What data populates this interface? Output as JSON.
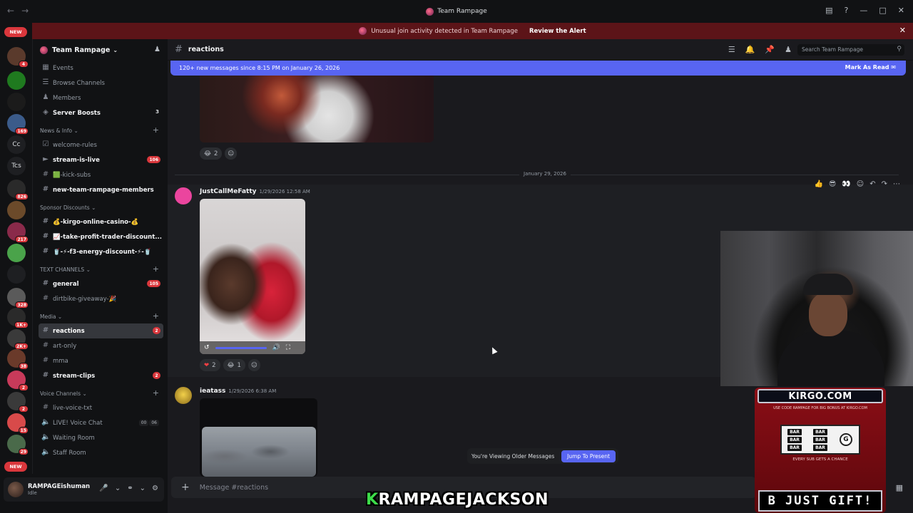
{
  "titlebar": {
    "title": "Team Rampage"
  },
  "alert": {
    "text": "Unusual join activity detected in Team Rampage",
    "link": "Review the Alert"
  },
  "rail": {
    "new_top": "NEW",
    "new_bottom": "NEW",
    "servers": [
      {
        "label": "",
        "badge": "4"
      },
      {
        "label": "",
        "badge": ""
      },
      {
        "label": "",
        "badge": ""
      },
      {
        "label": "",
        "badge": "169"
      },
      {
        "label": "Cc",
        "badge": ""
      },
      {
        "label": "Tcs",
        "badge": ""
      },
      {
        "label": "",
        "badge": "826"
      },
      {
        "label": "",
        "badge": ""
      },
      {
        "label": "",
        "badge": "217"
      },
      {
        "label": "",
        "badge": ""
      },
      {
        "label": "",
        "badge": ""
      },
      {
        "label": "",
        "badge": "328"
      },
      {
        "label": "",
        "badge": "1K+"
      },
      {
        "label": "",
        "badge": "2K+"
      },
      {
        "label": "",
        "badge": "38"
      },
      {
        "label": "",
        "badge": "2"
      },
      {
        "label": "",
        "badge": "2"
      },
      {
        "label": "",
        "badge": "15"
      },
      {
        "label": "",
        "badge": "29"
      }
    ]
  },
  "server": {
    "name": "Team Rampage"
  },
  "sidebar": {
    "events": "Events",
    "browse": "Browse Channels",
    "members": "Members",
    "boosts": "Server Boosts",
    "boosts_badge": "3",
    "cat_news": "News & Info",
    "welcome": "welcome-rules",
    "stream_live": "stream-is-live",
    "stream_live_badge": "106",
    "kick_subs": "🟩-kick-subs",
    "new_members": "new-team-rampage-members",
    "cat_sponsor": "Sponsor Discounts",
    "casino": "💰-kirgo-online-casino-💰",
    "takeprofit": "📈-take-profit-trader-discount...",
    "energy": "🥤-⚡-f3-energy-discount-⚡-🥤",
    "cat_text": "TEXT CHANNELS",
    "general": "general",
    "general_badge": "105",
    "dirtbike": "dirtbike-giveaway-🎉",
    "cat_media": "Media",
    "reactions": "reactions",
    "reactions_badge": "2",
    "artonly": "art-only",
    "mma": "mma",
    "clips": "stream-clips",
    "clips_badge": "2",
    "cat_voice": "Voice Channels",
    "livevoicetxt": "live-voice-txt",
    "livevc": "LIVE! Voice Chat",
    "livevc_n1": "00",
    "livevc_n2": "06",
    "waiting": "Waiting Room",
    "staff": "Staff Room"
  },
  "user": {
    "name": "RAMPAGEishuman",
    "status": "Idle"
  },
  "channel": {
    "name": "reactions",
    "search_placeholder": "Search Team Rampage"
  },
  "newbar": {
    "text": "120+ new messages since 8:15 PM on January 26, 2026",
    "action": "Mark As Read"
  },
  "messages": {
    "top_react_count": "2",
    "date_divider": "January 29, 2026",
    "m1": {
      "author": "JustCallMeFatty",
      "time": "1/29/2026 12:58 AM",
      "heart_count": "2",
      "laugh_count": "1"
    },
    "m2": {
      "author": "ieatass",
      "time": "1/29/2026 6:38 AM"
    }
  },
  "older": {
    "text": "You're Viewing Older Messages",
    "jump": "Jump To Present"
  },
  "composer": {
    "placeholder": "Message #reactions"
  },
  "overlay": {
    "site": "KIRGO.COM",
    "promo": "USE CODE RAMPAGE FOR BIG BONUS AT KIRGO.COM",
    "chance": "EVERY SUB GETS A CHANCE",
    "reel_label": "BAR",
    "reel_g": "G",
    "ticker": "B JUST GIFT!",
    "nameplate_k": "K",
    "nameplate_rest": "RAMPAGEJACKSON"
  }
}
